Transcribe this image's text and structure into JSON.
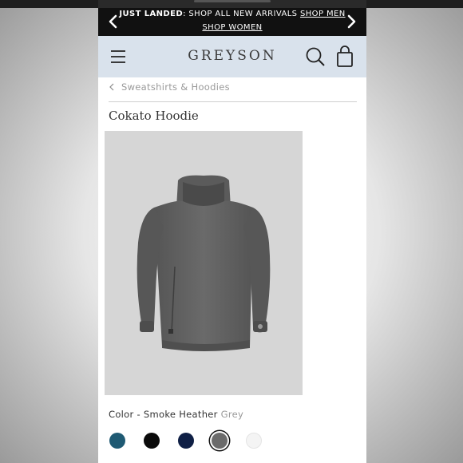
{
  "promo": {
    "lead_bold": "JUST LANDED",
    "lead_text": ": SHOP ALL NEW ARRIVALS ",
    "shop_men": "SHOP MEN",
    "shop_women": "SHOP WOMEN"
  },
  "header": {
    "logo": "GREYSON"
  },
  "breadcrumb": {
    "label": "Sweatshirts & Hoodies"
  },
  "product": {
    "title": "Cokato Hoodie",
    "color_prefix": "Color - ",
    "color_name": "Smoke Heather",
    "color_suffix": " Grey"
  },
  "swatches": [
    {
      "name": "teal",
      "color": "#1f5a73",
      "selected": false
    },
    {
      "name": "black",
      "color": "#0a0a0a",
      "selected": false
    },
    {
      "name": "navy",
      "color": "#0f1f45",
      "selected": false
    },
    {
      "name": "smoke-heather-grey",
      "color": "#6b6b6b",
      "selected": true
    },
    {
      "name": "white",
      "color": "#f4f4f4",
      "selected": false
    }
  ],
  "icons": [
    "chevron-left-icon",
    "chevron-right-icon",
    "hamburger-menu-icon",
    "search-icon",
    "shopping-bag-icon",
    "breadcrumb-back-icon"
  ]
}
